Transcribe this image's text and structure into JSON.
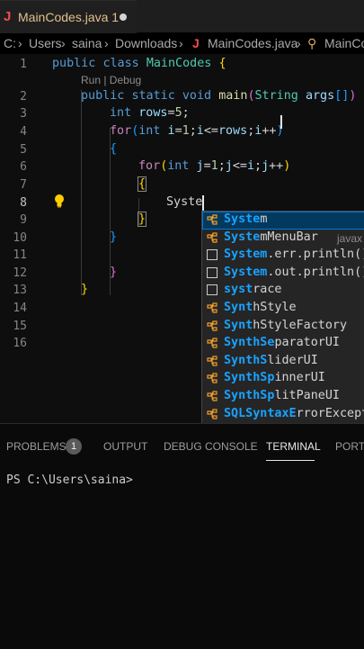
{
  "tab": {
    "icon": "java-file-icon",
    "title": "MainCodes.java 1"
  },
  "breadcrumb": [
    "C:",
    "Users",
    "saina",
    "Downloads",
    "MainCodes.java",
    "MainCo"
  ],
  "codelens": "Run | Debug",
  "line_numbers": [
    "1",
    "2",
    "3",
    "4",
    "5",
    "6",
    "7",
    "8",
    "9",
    "10",
    "11",
    "12",
    "13",
    "14",
    "15",
    "16"
  ],
  "active_line": "8",
  "code": {
    "l1": [
      "public",
      "class",
      "MainCodes",
      "{"
    ],
    "l2": [
      "public",
      "static",
      "void",
      "main",
      "(",
      "String",
      "args",
      "[]",
      ")",
      "{"
    ],
    "l3": [
      "int",
      "rows",
      "=",
      "5",
      ";"
    ],
    "l4": [
      "for",
      "(",
      "int",
      "i",
      "=",
      "1",
      ";",
      "i",
      "<=",
      "rows",
      ";",
      "i",
      "++",
      ")"
    ],
    "l5": [
      "{"
    ],
    "l6": [
      "for",
      "(",
      "int",
      "j",
      "=",
      "1",
      ";",
      "j",
      "<=",
      "i",
      ";",
      "j",
      "++",
      ")"
    ],
    "l7": [
      "{"
    ],
    "l8": [
      "Syste"
    ],
    "l9": [
      "}"
    ],
    "l10": [
      "}"
    ],
    "l12": [
      "}"
    ],
    "l13": [
      "}"
    ]
  },
  "suggestions": [
    {
      "match": "Syste",
      "rest": "m",
      "detail": "",
      "icon": "class-icon",
      "selected": true
    },
    {
      "match": "Syste",
      "rest": "mMenuBar",
      "detail": "javax",
      "icon": "class-icon",
      "selected": false
    },
    {
      "match": "System",
      "rest": ".err.println()",
      "detail": "",
      "icon": "snippet-icon",
      "selected": false
    },
    {
      "match": "System",
      "rest": ".out.println()",
      "detail": "",
      "icon": "snippet-icon",
      "selected": false
    },
    {
      "match": "syst",
      "rest": "race",
      "detail": "",
      "icon": "snippet-icon",
      "selected": false
    },
    {
      "match": "Synt",
      "rest": "hStyle",
      "detail": "",
      "icon": "class-icon",
      "selected": false
    },
    {
      "match": "Synt",
      "rest": "hStyleFactory",
      "detail": "",
      "icon": "class-icon",
      "selected": false
    },
    {
      "match": "SynthSe",
      "rest": "paratorUI",
      "detail": "",
      "icon": "class-icon",
      "selected": false
    },
    {
      "match": "SynthS",
      "rest": "liderUI",
      "detail": "",
      "icon": "class-icon",
      "selected": false
    },
    {
      "match": "SynthSp",
      "rest": "innerUI",
      "detail": "",
      "icon": "class-icon",
      "selected": false
    },
    {
      "match": "SynthSp",
      "rest": "litPaneUI",
      "detail": "",
      "icon": "class-icon",
      "selected": false
    },
    {
      "match": "SQLSyntaxE",
      "rest": "rrorExcept",
      "detail": "",
      "icon": "class-icon",
      "selected": false
    }
  ],
  "panel": {
    "tabs": [
      "PROBLEMS",
      "OUTPUT",
      "DEBUG CONSOLE",
      "TERMINAL",
      "PORTS"
    ],
    "active_tab": "TERMINAL",
    "problems_count": "1",
    "terminal_prompt": "PS C:\\Users\\saina>"
  },
  "colors": {
    "keyword": "#569cd6",
    "type": "#4ec9b0",
    "function": "#dcdcaa",
    "variable": "#9cdcfe",
    "number": "#b5cea8",
    "match_highlight": "#18a3ff",
    "tab_title": "#e2c08d"
  }
}
